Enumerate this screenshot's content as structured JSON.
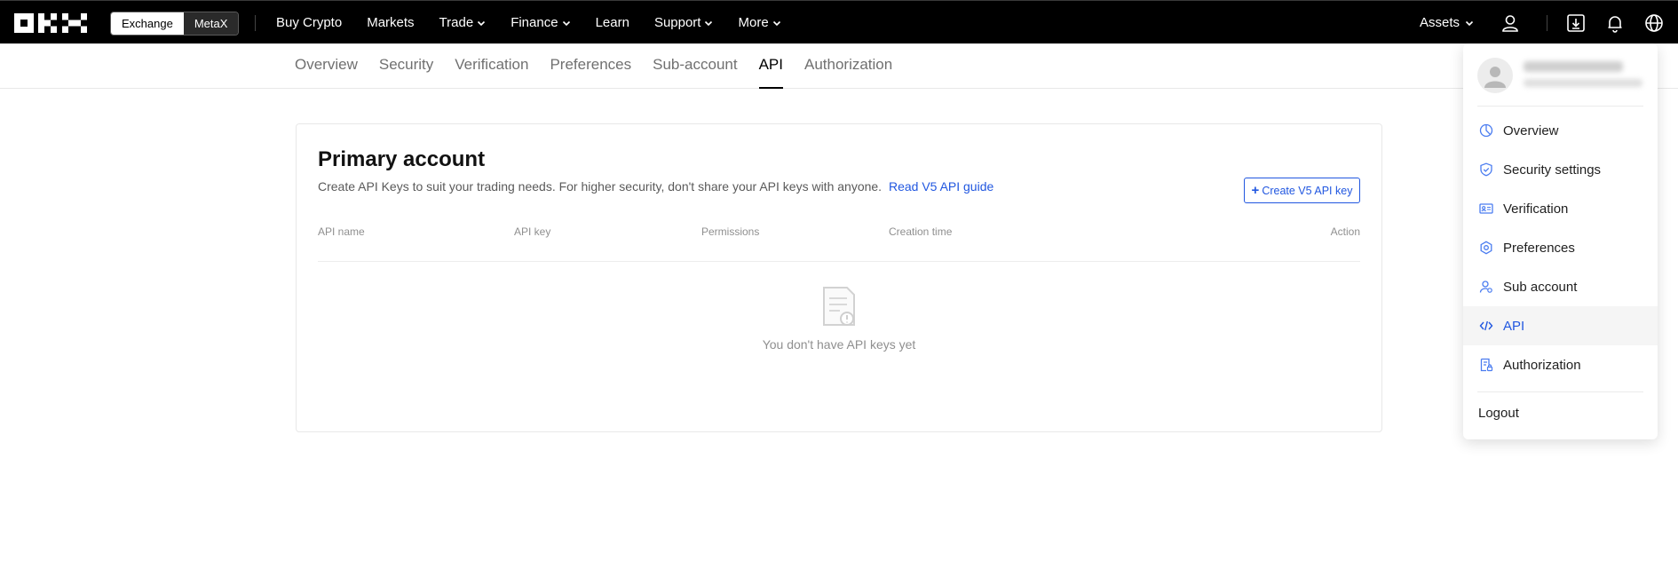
{
  "topbar": {
    "logo": "OKX",
    "switch": [
      "Exchange",
      "MetaX"
    ],
    "nav": [
      {
        "label": "Buy Crypto",
        "dropdown": false
      },
      {
        "label": "Markets",
        "dropdown": false
      },
      {
        "label": "Trade",
        "dropdown": true
      },
      {
        "label": "Finance",
        "dropdown": true
      },
      {
        "label": "Learn",
        "dropdown": false
      },
      {
        "label": "Support",
        "dropdown": true
      },
      {
        "label": "More",
        "dropdown": true
      }
    ],
    "assets_label": "Assets",
    "icons": [
      "user-icon",
      "download-icon",
      "bell-icon",
      "globe-icon"
    ]
  },
  "subnav": {
    "tabs": [
      "Overview",
      "Security",
      "Verification",
      "Preferences",
      "Sub-account",
      "API",
      "Authorization"
    ],
    "active": "API"
  },
  "card": {
    "title": "Primary account",
    "desc": "Create API Keys to suit your trading needs. For higher security, don't share your API keys with anyone.",
    "guide_link": "Read V5 API guide",
    "create_button": "Create V5 API key",
    "columns": [
      "API name",
      "API key",
      "Permissions",
      "Creation time",
      "Action"
    ],
    "empty_text": "You don't have API keys yet"
  },
  "dropdown": {
    "items": [
      {
        "label": "Overview",
        "icon": "chart-pie-icon"
      },
      {
        "label": "Security settings",
        "icon": "shield-icon"
      },
      {
        "label": "Verification",
        "icon": "id-card-icon"
      },
      {
        "label": "Preferences",
        "icon": "gear-icon"
      },
      {
        "label": "Sub account",
        "icon": "sub-account-icon"
      },
      {
        "label": "API",
        "icon": "code-icon"
      },
      {
        "label": "Authorization",
        "icon": "authorization-icon"
      }
    ],
    "active": "API",
    "logout": "Logout"
  },
  "colors": {
    "accent": "#2157e0",
    "topbar_bg": "#000000",
    "menu_icon": "#4a7cf0"
  }
}
